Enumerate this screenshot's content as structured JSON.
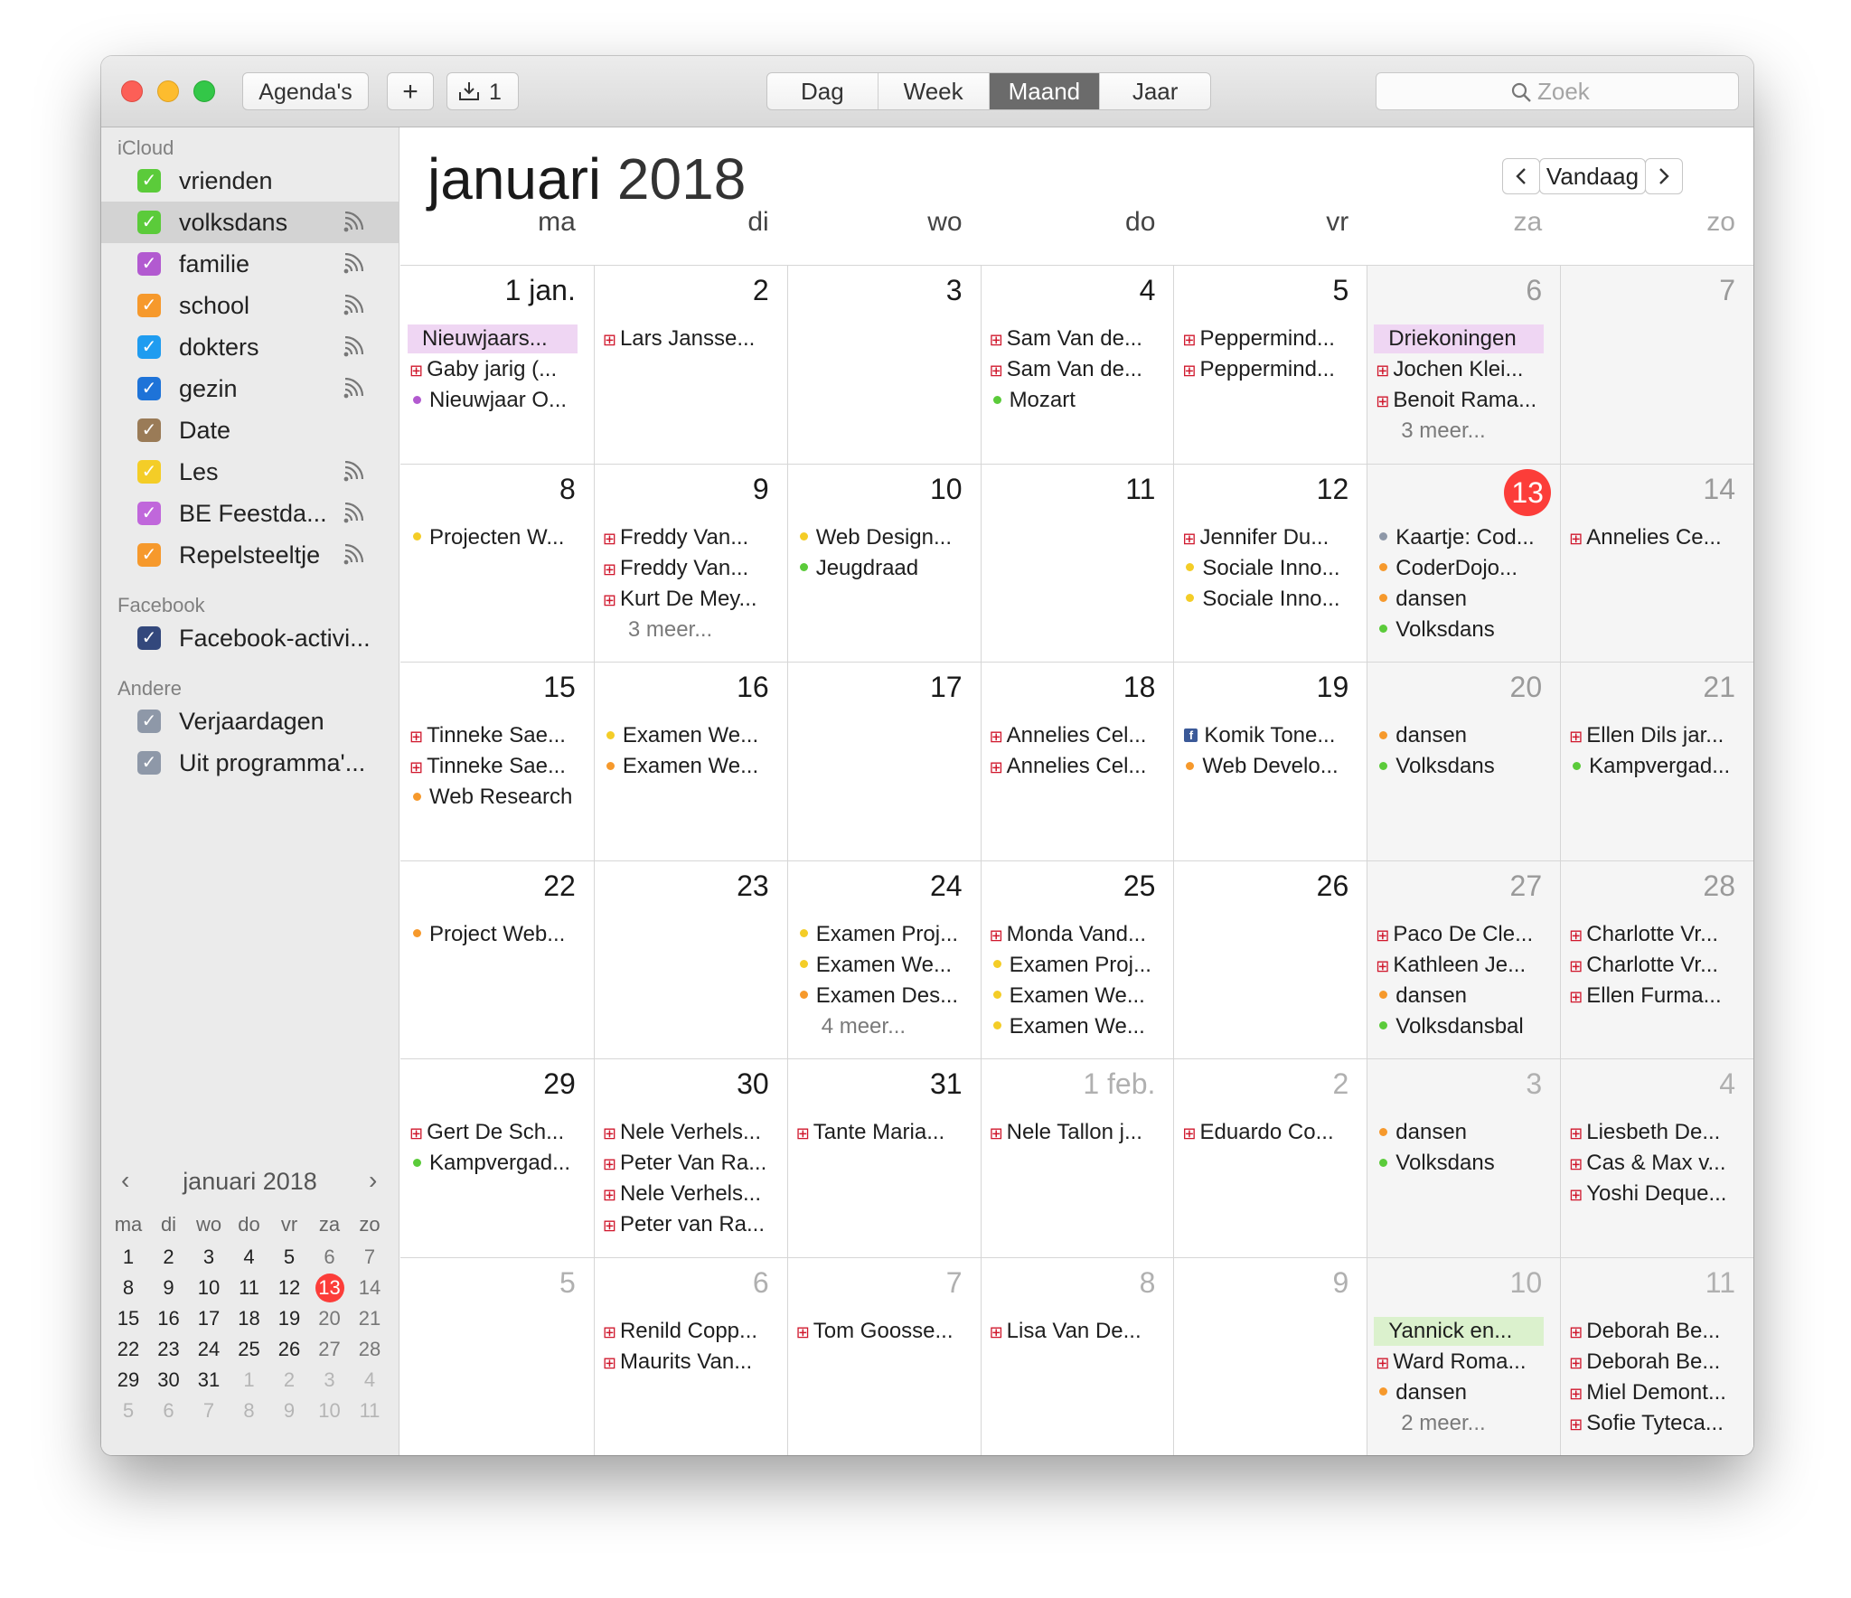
{
  "window": {
    "toolbar": {
      "calendars_label": "Agenda's",
      "add_label": "+",
      "inbox_count": "1",
      "views": [
        {
          "label": "Dag",
          "active": false
        },
        {
          "label": "Week",
          "active": false
        },
        {
          "label": "Maand",
          "active": true
        },
        {
          "label": "Jaar",
          "active": false
        }
      ],
      "search_placeholder": "Zoek"
    }
  },
  "sidebar": {
    "sections": [
      {
        "title": "iCloud",
        "items": [
          {
            "name": "vrienden",
            "color": "#5bcb3a",
            "shared": false,
            "selected": false
          },
          {
            "name": "volksdans",
            "color": "#5bcb3a",
            "shared": true,
            "selected": true
          },
          {
            "name": "familie",
            "color": "#b25ad0",
            "shared": true,
            "selected": false
          },
          {
            "name": "school",
            "color": "#f6992c",
            "shared": true,
            "selected": false
          },
          {
            "name": "dokters",
            "color": "#1f9cf0",
            "shared": true,
            "selected": false
          },
          {
            "name": "gezin",
            "color": "#1e73d8",
            "shared": true,
            "selected": false
          },
          {
            "name": "Date",
            "color": "#9a7b57",
            "shared": false,
            "selected": false
          },
          {
            "name": "Les",
            "color": "#f4cd27",
            "shared": true,
            "selected": false
          },
          {
            "name": "BE Feestda...",
            "color": "#c067db",
            "shared": true,
            "selected": false
          },
          {
            "name": "Repelsteeltje",
            "color": "#f6992c",
            "shared": true,
            "selected": false
          }
        ]
      },
      {
        "title": "Facebook",
        "items": [
          {
            "name": "Facebook-activi...",
            "color": "#33487c",
            "shared": false,
            "selected": false
          }
        ]
      },
      {
        "title": "Andere",
        "items": [
          {
            "name": "Verjaardagen",
            "color": "#8e98a8",
            "shared": false,
            "selected": false
          },
          {
            "name": "Uit programma'...",
            "color": "#8e98a8",
            "shared": false,
            "selected": false
          }
        ]
      }
    ],
    "mini_calendar": {
      "title": "januari 2018",
      "weekdays": [
        "ma",
        "di",
        "wo",
        "do",
        "vr",
        "za",
        "zo"
      ],
      "weeks": [
        [
          [
            "1",
            0
          ],
          [
            "2",
            0
          ],
          [
            "3",
            0
          ],
          [
            "4",
            0
          ],
          [
            "5",
            0
          ],
          [
            "6",
            0
          ],
          [
            "7",
            0
          ]
        ],
        [
          [
            "8",
            0
          ],
          [
            "9",
            0
          ],
          [
            "10",
            0
          ],
          [
            "11",
            0
          ],
          [
            "12",
            0
          ],
          [
            "13",
            2
          ],
          [
            "14",
            0
          ]
        ],
        [
          [
            "15",
            0
          ],
          [
            "16",
            0
          ],
          [
            "17",
            0
          ],
          [
            "18",
            0
          ],
          [
            "19",
            0
          ],
          [
            "20",
            0
          ],
          [
            "21",
            0
          ]
        ],
        [
          [
            "22",
            0
          ],
          [
            "23",
            0
          ],
          [
            "24",
            0
          ],
          [
            "25",
            0
          ],
          [
            "26",
            0
          ],
          [
            "27",
            0
          ],
          [
            "28",
            0
          ]
        ],
        [
          [
            "29",
            0
          ],
          [
            "30",
            0
          ],
          [
            "31",
            0
          ],
          [
            "1",
            1
          ],
          [
            "2",
            1
          ],
          [
            "3",
            1
          ],
          [
            "4",
            1
          ]
        ],
        [
          [
            "5",
            1
          ],
          [
            "6",
            1
          ],
          [
            "7",
            1
          ],
          [
            "8",
            1
          ],
          [
            "9",
            1
          ],
          [
            "10",
            1
          ],
          [
            "11",
            1
          ]
        ]
      ]
    }
  },
  "main": {
    "month": "januari",
    "year": "2018",
    "today_label": "Vandaag",
    "weekdays": [
      "ma",
      "di",
      "wo",
      "do",
      "vr",
      "za",
      "zo"
    ],
    "colors": {
      "school": "#f6992c",
      "les": "#f4cd27",
      "volksdans": "#5bcb3a",
      "familie": "#b25ad0",
      "gift": "#d0182d",
      "grey": "#8e98a8",
      "allday_pink": "#efd6f3",
      "allday_green": "#dbf1cd",
      "today": "#fc3d39"
    },
    "weeks": [
      [
        {
          "day": "1 jan.",
          "other": false,
          "events": [
            {
              "k": "allday",
              "t": "Nieuwjaars...",
              "c": "allday_pink"
            },
            {
              "k": "gift",
              "t": "Gaby jarig (..."
            },
            {
              "k": "dot",
              "t": "Nieuwjaar O...",
              "c": "familie"
            }
          ]
        },
        {
          "day": "2",
          "other": false,
          "events": [
            {
              "k": "gift",
              "t": "Lars Jansse..."
            }
          ]
        },
        {
          "day": "3",
          "other": false,
          "events": []
        },
        {
          "day": "4",
          "other": false,
          "events": [
            {
              "k": "gift",
              "t": "Sam Van de..."
            },
            {
              "k": "gift",
              "t": "Sam Van de..."
            },
            {
              "k": "dot",
              "t": "Mozart",
              "c": "volksdans"
            }
          ]
        },
        {
          "day": "5",
          "other": false,
          "events": [
            {
              "k": "gift",
              "t": "Peppermind..."
            },
            {
              "k": "gift",
              "t": "Peppermind..."
            }
          ]
        },
        {
          "day": "6",
          "other": false,
          "events": [
            {
              "k": "allday",
              "t": "Driekoningen",
              "c": "allday_pink"
            },
            {
              "k": "gift",
              "t": "Jochen Klei..."
            },
            {
              "k": "gift",
              "t": "Benoit Rama..."
            },
            {
              "k": "more",
              "t": "3 meer..."
            }
          ]
        },
        {
          "day": "7",
          "other": false,
          "events": []
        }
      ],
      [
        {
          "day": "8",
          "other": false,
          "events": [
            {
              "k": "dot",
              "t": "Projecten W...",
              "c": "les"
            }
          ]
        },
        {
          "day": "9",
          "other": false,
          "events": [
            {
              "k": "gift",
              "t": "Freddy Van..."
            },
            {
              "k": "gift",
              "t": "Freddy Van..."
            },
            {
              "k": "gift",
              "t": "Kurt De Mey..."
            },
            {
              "k": "more",
              "t": "3 meer..."
            }
          ]
        },
        {
          "day": "10",
          "other": false,
          "events": [
            {
              "k": "dot",
              "t": "Web Design...",
              "c": "les"
            },
            {
              "k": "dot",
              "t": "Jeugdraad",
              "c": "volksdans"
            }
          ]
        },
        {
          "day": "11",
          "other": false,
          "events": []
        },
        {
          "day": "12",
          "other": false,
          "events": [
            {
              "k": "gift",
              "t": "Jennifer Du..."
            },
            {
              "k": "dot",
              "t": "Sociale Inno...",
              "c": "les"
            },
            {
              "k": "dot",
              "t": "Sociale Inno...",
              "c": "les"
            }
          ]
        },
        {
          "day": "13",
          "other": false,
          "today": true,
          "events": [
            {
              "k": "dot",
              "t": "Kaartje: Cod...",
              "c": "grey"
            },
            {
              "k": "dot",
              "t": "CoderDojo...",
              "c": "school"
            },
            {
              "k": "dot",
              "t": "dansen",
              "c": "school"
            },
            {
              "k": "dot",
              "t": "Volksdans",
              "c": "volksdans"
            }
          ]
        },
        {
          "day": "14",
          "other": false,
          "events": [
            {
              "k": "gift",
              "t": "Annelies Ce..."
            }
          ]
        }
      ],
      [
        {
          "day": "15",
          "other": false,
          "events": [
            {
              "k": "gift",
              "t": "Tinneke Sae..."
            },
            {
              "k": "gift",
              "t": "Tinneke Sae..."
            },
            {
              "k": "dot",
              "t": "Web Research",
              "c": "school"
            }
          ]
        },
        {
          "day": "16",
          "other": false,
          "events": [
            {
              "k": "dot",
              "t": "Examen We...",
              "c": "les"
            },
            {
              "k": "dot",
              "t": "Examen We...",
              "c": "school"
            }
          ]
        },
        {
          "day": "17",
          "other": false,
          "events": []
        },
        {
          "day": "18",
          "other": false,
          "events": [
            {
              "k": "gift",
              "t": "Annelies Cel..."
            },
            {
              "k": "gift",
              "t": "Annelies Cel..."
            }
          ]
        },
        {
          "day": "19",
          "other": false,
          "events": [
            {
              "k": "fb",
              "t": "Komik Tone..."
            },
            {
              "k": "dot",
              "t": "Web Develo...",
              "c": "school"
            }
          ]
        },
        {
          "day": "20",
          "other": false,
          "events": [
            {
              "k": "dot",
              "t": "dansen",
              "c": "school"
            },
            {
              "k": "dot",
              "t": "Volksdans",
              "c": "volksdans"
            }
          ]
        },
        {
          "day": "21",
          "other": false,
          "events": [
            {
              "k": "gift",
              "t": "Ellen Dils jar..."
            },
            {
              "k": "dot",
              "t": "Kampvergad...",
              "c": "volksdans"
            }
          ]
        }
      ],
      [
        {
          "day": "22",
          "other": false,
          "events": [
            {
              "k": "dot",
              "t": "Project Web...",
              "c": "school"
            }
          ]
        },
        {
          "day": "23",
          "other": false,
          "events": []
        },
        {
          "day": "24",
          "other": false,
          "events": [
            {
              "k": "dot",
              "t": "Examen Proj...",
              "c": "les"
            },
            {
              "k": "dot",
              "t": "Examen We...",
              "c": "les"
            },
            {
              "k": "dot",
              "t": "Examen Des...",
              "c": "school"
            },
            {
              "k": "more",
              "t": "4 meer..."
            }
          ]
        },
        {
          "day": "25",
          "other": false,
          "events": [
            {
              "k": "gift",
              "t": "Monda Vand..."
            },
            {
              "k": "dot",
              "t": "Examen Proj...",
              "c": "les"
            },
            {
              "k": "dot",
              "t": "Examen We...",
              "c": "les"
            },
            {
              "k": "dot",
              "t": "Examen We...",
              "c": "les"
            }
          ]
        },
        {
          "day": "26",
          "other": false,
          "events": []
        },
        {
          "day": "27",
          "other": false,
          "events": [
            {
              "k": "gift",
              "t": "Paco De Cle..."
            },
            {
              "k": "gift",
              "t": "Kathleen Je..."
            },
            {
              "k": "dot",
              "t": "dansen",
              "c": "school"
            },
            {
              "k": "dot",
              "t": "Volksdansbal",
              "c": "volksdans"
            }
          ]
        },
        {
          "day": "28",
          "other": false,
          "events": [
            {
              "k": "gift",
              "t": "Charlotte Vr..."
            },
            {
              "k": "gift",
              "t": "Charlotte Vr..."
            },
            {
              "k": "gift",
              "t": "Ellen Furma..."
            }
          ]
        }
      ],
      [
        {
          "day": "29",
          "other": false,
          "events": [
            {
              "k": "gift",
              "t": "Gert De Sch..."
            },
            {
              "k": "dot",
              "t": "Kampvergad...",
              "c": "volksdans"
            }
          ]
        },
        {
          "day": "30",
          "other": false,
          "events": [
            {
              "k": "gift",
              "t": "Nele Verhels..."
            },
            {
              "k": "gift",
              "t": "Peter Van Ra..."
            },
            {
              "k": "gift",
              "t": "Nele Verhels..."
            },
            {
              "k": "gift",
              "t": "Peter van Ra..."
            }
          ]
        },
        {
          "day": "31",
          "other": false,
          "events": [
            {
              "k": "gift",
              "t": "Tante Maria..."
            }
          ]
        },
        {
          "day": "1 feb.",
          "other": true,
          "events": [
            {
              "k": "gift",
              "t": "Nele Tallon j..."
            }
          ]
        },
        {
          "day": "2",
          "other": true,
          "events": [
            {
              "k": "gift",
              "t": "Eduardo Co..."
            }
          ]
        },
        {
          "day": "3",
          "other": true,
          "events": [
            {
              "k": "dot",
              "t": "dansen",
              "c": "school"
            },
            {
              "k": "dot",
              "t": "Volksdans",
              "c": "volksdans"
            }
          ]
        },
        {
          "day": "4",
          "other": true,
          "events": [
            {
              "k": "gift",
              "t": "Liesbeth De..."
            },
            {
              "k": "gift",
              "t": "Cas & Max v..."
            },
            {
              "k": "gift",
              "t": "Yoshi Deque..."
            }
          ]
        }
      ],
      [
        {
          "day": "5",
          "other": true,
          "events": []
        },
        {
          "day": "6",
          "other": true,
          "events": [
            {
              "k": "gift",
              "t": "Renild Copp..."
            },
            {
              "k": "gift",
              "t": "Maurits Van..."
            }
          ]
        },
        {
          "day": "7",
          "other": true,
          "events": [
            {
              "k": "gift",
              "t": "Tom Goosse..."
            }
          ]
        },
        {
          "day": "8",
          "other": true,
          "events": [
            {
              "k": "gift",
              "t": "Lisa Van De..."
            }
          ]
        },
        {
          "day": "9",
          "other": true,
          "events": []
        },
        {
          "day": "10",
          "other": true,
          "events": [
            {
              "k": "allday",
              "t": "Yannick en...",
              "c": "allday_green"
            },
            {
              "k": "gift",
              "t": "Ward Roma..."
            },
            {
              "k": "dot",
              "t": "dansen",
              "c": "school"
            },
            {
              "k": "more",
              "t": "2 meer..."
            }
          ]
        },
        {
          "day": "11",
          "other": true,
          "events": [
            {
              "k": "gift",
              "t": "Deborah Be..."
            },
            {
              "k": "gift",
              "t": "Deborah Be..."
            },
            {
              "k": "gift",
              "t": "Miel Demont..."
            },
            {
              "k": "gift",
              "t": "Sofie Tyteca..."
            }
          ]
        }
      ]
    ]
  }
}
